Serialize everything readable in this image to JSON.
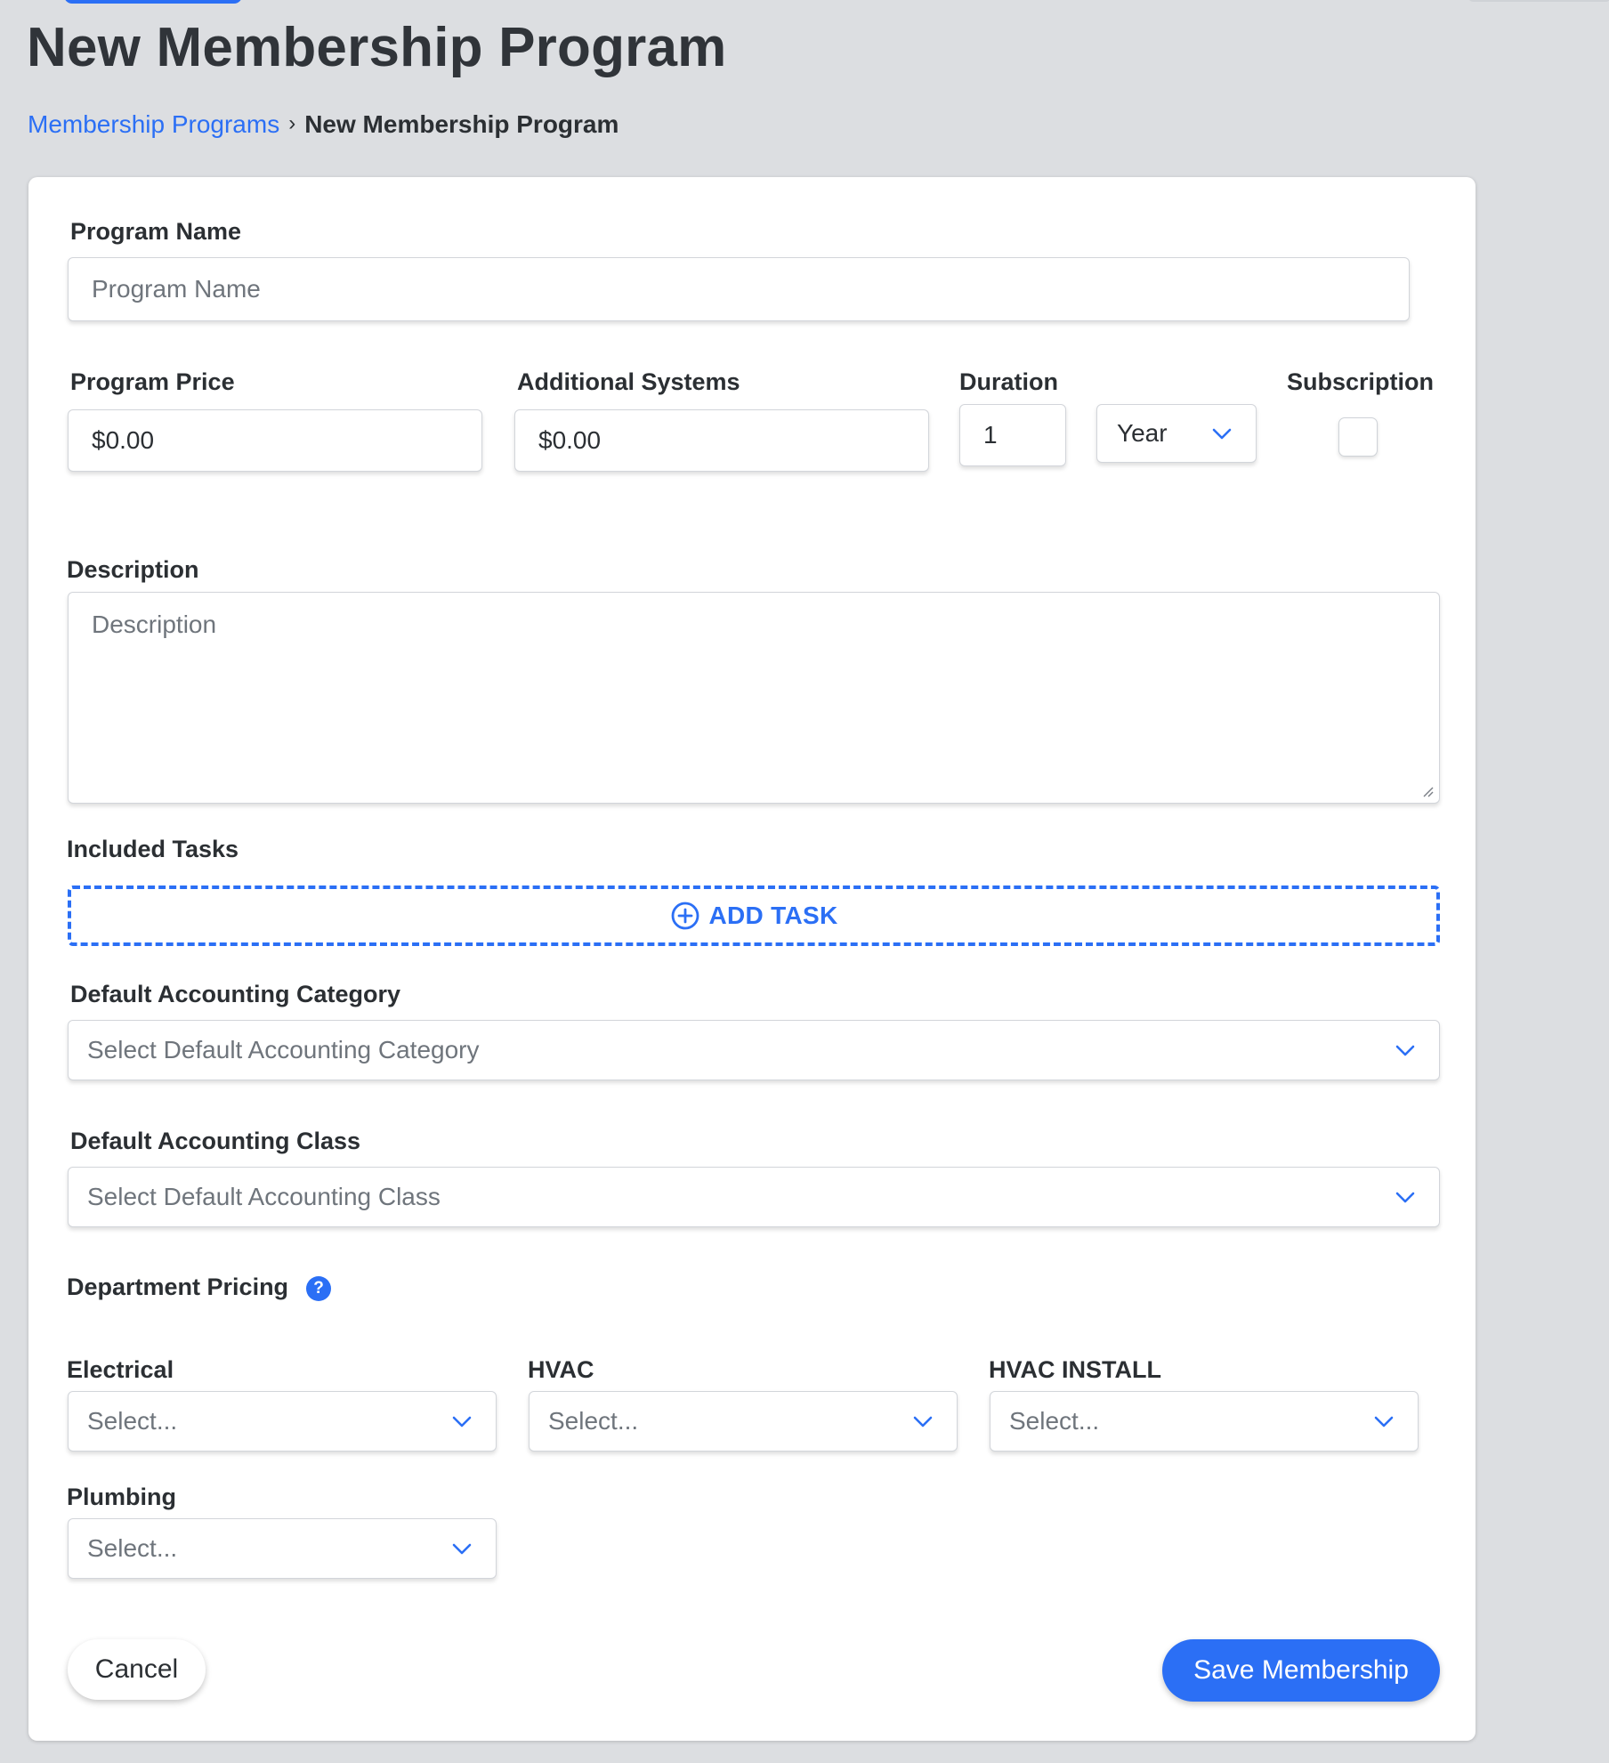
{
  "page": {
    "title": "New Membership Program"
  },
  "breadcrumb": {
    "parent": "Membership Programs",
    "separator": "›",
    "current": "New Membership Program"
  },
  "form": {
    "program_name": {
      "label": "Program Name",
      "placeholder": "Program Name",
      "value": ""
    },
    "program_price": {
      "label": "Program Price",
      "value": "$0.00"
    },
    "additional_systems": {
      "label": "Additional Systems",
      "value": "$0.00"
    },
    "duration": {
      "label": "Duration",
      "value": "1",
      "unit": "Year"
    },
    "subscription": {
      "label": "Subscription",
      "checked": false
    },
    "description": {
      "label": "Description",
      "placeholder": "Description",
      "value": ""
    },
    "included_tasks": {
      "label": "Included Tasks",
      "add_label": "ADD TASK"
    },
    "accounting_category": {
      "label": "Default Accounting Category",
      "placeholder": "Select Default Accounting Category"
    },
    "accounting_class": {
      "label": "Default Accounting Class",
      "placeholder": "Select Default Accounting Class"
    },
    "department_pricing": {
      "label": "Department Pricing",
      "help": "?",
      "departments": [
        {
          "label": "Electrical",
          "placeholder": "Select..."
        },
        {
          "label": "HVAC",
          "placeholder": "Select..."
        },
        {
          "label": "HVAC INSTALL",
          "placeholder": "Select..."
        },
        {
          "label": "Plumbing",
          "placeholder": "Select..."
        }
      ]
    }
  },
  "actions": {
    "cancel_label": "Cancel",
    "save_label": "Save Membership"
  },
  "colors": {
    "accent": "#2b6ff5",
    "background": "#dcdee1",
    "card": "#ffffff"
  }
}
